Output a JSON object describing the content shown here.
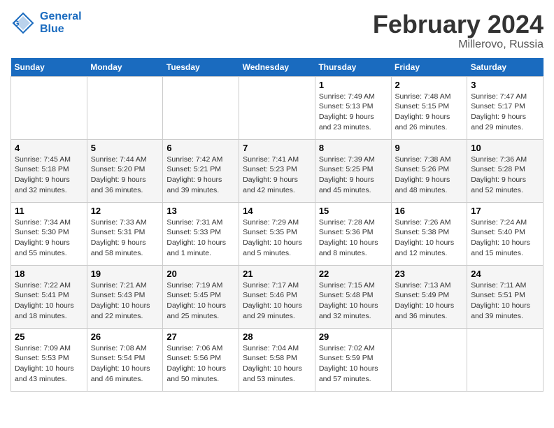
{
  "header": {
    "logo_line1": "General",
    "logo_line2": "Blue",
    "month_year": "February 2024",
    "location": "Millerovo, Russia"
  },
  "weekdays": [
    "Sunday",
    "Monday",
    "Tuesday",
    "Wednesday",
    "Thursday",
    "Friday",
    "Saturday"
  ],
  "weeks": [
    [
      {
        "day": "",
        "info": ""
      },
      {
        "day": "",
        "info": ""
      },
      {
        "day": "",
        "info": ""
      },
      {
        "day": "",
        "info": ""
      },
      {
        "day": "1",
        "info": "Sunrise: 7:49 AM\nSunset: 5:13 PM\nDaylight: 9 hours\nand 23 minutes."
      },
      {
        "day": "2",
        "info": "Sunrise: 7:48 AM\nSunset: 5:15 PM\nDaylight: 9 hours\nand 26 minutes."
      },
      {
        "day": "3",
        "info": "Sunrise: 7:47 AM\nSunset: 5:17 PM\nDaylight: 9 hours\nand 29 minutes."
      }
    ],
    [
      {
        "day": "4",
        "info": "Sunrise: 7:45 AM\nSunset: 5:18 PM\nDaylight: 9 hours\nand 32 minutes."
      },
      {
        "day": "5",
        "info": "Sunrise: 7:44 AM\nSunset: 5:20 PM\nDaylight: 9 hours\nand 36 minutes."
      },
      {
        "day": "6",
        "info": "Sunrise: 7:42 AM\nSunset: 5:21 PM\nDaylight: 9 hours\nand 39 minutes."
      },
      {
        "day": "7",
        "info": "Sunrise: 7:41 AM\nSunset: 5:23 PM\nDaylight: 9 hours\nand 42 minutes."
      },
      {
        "day": "8",
        "info": "Sunrise: 7:39 AM\nSunset: 5:25 PM\nDaylight: 9 hours\nand 45 minutes."
      },
      {
        "day": "9",
        "info": "Sunrise: 7:38 AM\nSunset: 5:26 PM\nDaylight: 9 hours\nand 48 minutes."
      },
      {
        "day": "10",
        "info": "Sunrise: 7:36 AM\nSunset: 5:28 PM\nDaylight: 9 hours\nand 52 minutes."
      }
    ],
    [
      {
        "day": "11",
        "info": "Sunrise: 7:34 AM\nSunset: 5:30 PM\nDaylight: 9 hours\nand 55 minutes."
      },
      {
        "day": "12",
        "info": "Sunrise: 7:33 AM\nSunset: 5:31 PM\nDaylight: 9 hours\nand 58 minutes."
      },
      {
        "day": "13",
        "info": "Sunrise: 7:31 AM\nSunset: 5:33 PM\nDaylight: 10 hours\nand 1 minute."
      },
      {
        "day": "14",
        "info": "Sunrise: 7:29 AM\nSunset: 5:35 PM\nDaylight: 10 hours\nand 5 minutes."
      },
      {
        "day": "15",
        "info": "Sunrise: 7:28 AM\nSunset: 5:36 PM\nDaylight: 10 hours\nand 8 minutes."
      },
      {
        "day": "16",
        "info": "Sunrise: 7:26 AM\nSunset: 5:38 PM\nDaylight: 10 hours\nand 12 minutes."
      },
      {
        "day": "17",
        "info": "Sunrise: 7:24 AM\nSunset: 5:40 PM\nDaylight: 10 hours\nand 15 minutes."
      }
    ],
    [
      {
        "day": "18",
        "info": "Sunrise: 7:22 AM\nSunset: 5:41 PM\nDaylight: 10 hours\nand 18 minutes."
      },
      {
        "day": "19",
        "info": "Sunrise: 7:21 AM\nSunset: 5:43 PM\nDaylight: 10 hours\nand 22 minutes."
      },
      {
        "day": "20",
        "info": "Sunrise: 7:19 AM\nSunset: 5:45 PM\nDaylight: 10 hours\nand 25 minutes."
      },
      {
        "day": "21",
        "info": "Sunrise: 7:17 AM\nSunset: 5:46 PM\nDaylight: 10 hours\nand 29 minutes."
      },
      {
        "day": "22",
        "info": "Sunrise: 7:15 AM\nSunset: 5:48 PM\nDaylight: 10 hours\nand 32 minutes."
      },
      {
        "day": "23",
        "info": "Sunrise: 7:13 AM\nSunset: 5:49 PM\nDaylight: 10 hours\nand 36 minutes."
      },
      {
        "day": "24",
        "info": "Sunrise: 7:11 AM\nSunset: 5:51 PM\nDaylight: 10 hours\nand 39 minutes."
      }
    ],
    [
      {
        "day": "25",
        "info": "Sunrise: 7:09 AM\nSunset: 5:53 PM\nDaylight: 10 hours\nand 43 minutes."
      },
      {
        "day": "26",
        "info": "Sunrise: 7:08 AM\nSunset: 5:54 PM\nDaylight: 10 hours\nand 46 minutes."
      },
      {
        "day": "27",
        "info": "Sunrise: 7:06 AM\nSunset: 5:56 PM\nDaylight: 10 hours\nand 50 minutes."
      },
      {
        "day": "28",
        "info": "Sunrise: 7:04 AM\nSunset: 5:58 PM\nDaylight: 10 hours\nand 53 minutes."
      },
      {
        "day": "29",
        "info": "Sunrise: 7:02 AM\nSunset: 5:59 PM\nDaylight: 10 hours\nand 57 minutes."
      },
      {
        "day": "",
        "info": ""
      },
      {
        "day": "",
        "info": ""
      }
    ]
  ]
}
